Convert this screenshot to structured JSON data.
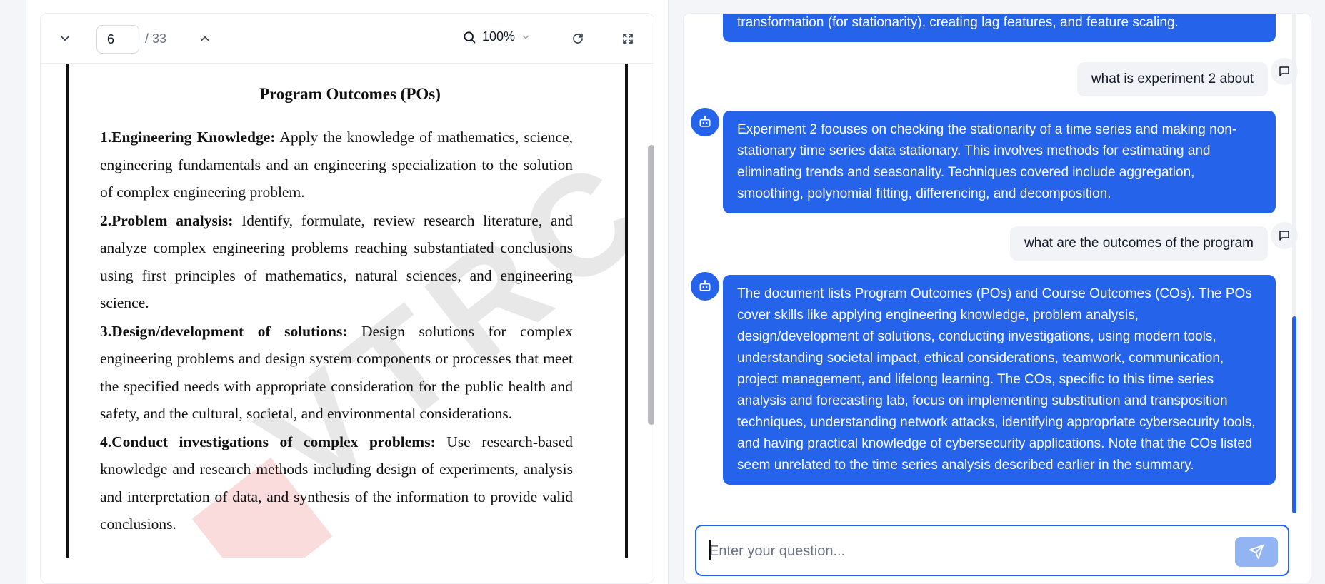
{
  "viewer": {
    "page_current": "6",
    "page_total": "/ 33",
    "zoom": "100%",
    "icons": [
      "chevron-down-icon",
      "chevron-up-icon",
      "search-icon",
      "refresh-icon",
      "fullscreen-icon"
    ],
    "document": {
      "title": "Program Outcomes (POs)",
      "items": [
        {
          "num": "1.",
          "heading": "Engineering Knowledge:",
          "text": " Apply the knowledge of mathematics, science, engineering fundamentals and an engineering specialization to the solution of complex engineering problem."
        },
        {
          "num": "2.",
          "heading": "Problem analysis:",
          "text": " Identify, formulate, review research literature, and analyze complex engineering problems reaching substantiated conclusions using first principles of mathematics, natural sciences, and engineering science."
        },
        {
          "num": "3.",
          "heading": "Design/development of solutions:",
          "text": " Design solutions for complex engineering problems and design system components or processes that meet the specified needs with appropriate consideration for the public health and safety, and the cultural, societal, and environmental considerations."
        },
        {
          "num": "4.",
          "heading": "Conduct investigations of complex problems:",
          "text": " Use research-based knowledge and research methods including design of experiments, analysis and interpretation of data, and synthesis of the information to provide valid conclusions."
        }
      ],
      "watermark": "VTRC"
    }
  },
  "chat": {
    "messages": [
      {
        "role": "bot",
        "text": "transformation (for stationarity), creating lag features, and feature scaling."
      },
      {
        "role": "user",
        "text": "what is experiment 2 about"
      },
      {
        "role": "bot",
        "text": "Experiment 2 focuses on checking the stationarity of a time series and making non-stationary time series data stationary. This involves methods for estimating and eliminating trends and seasonality. Techniques covered include aggregation, smoothing, polynomial fitting, differencing, and decomposition."
      },
      {
        "role": "user",
        "text": "what are the outcomes of the program"
      },
      {
        "role": "bot",
        "text": "The document lists Program Outcomes (POs) and Course Outcomes (COs). The POs cover skills like applying engineering knowledge, problem analysis, design/development of solutions, conducting investigations, using modern tools, understanding societal impact, ethical considerations, teamwork, communication, project management, and lifelong learning. The COs, specific to this time series analysis and forecasting lab, focus on implementing substitution and transposition techniques, understanding network attacks, identifying appropriate cybersecurity tools, and having practical knowledge of cybersecurity applications. Note that the COs listed seem unrelated to the time series analysis described earlier in the summary."
      }
    ],
    "input_placeholder": "Enter your question...",
    "icons": [
      "bot-icon",
      "feedback-icon",
      "send-icon"
    ]
  },
  "colors": {
    "accent": "#2563eb",
    "send_disabled": "#93b4f2",
    "user_bubble": "#f1f3f6"
  }
}
